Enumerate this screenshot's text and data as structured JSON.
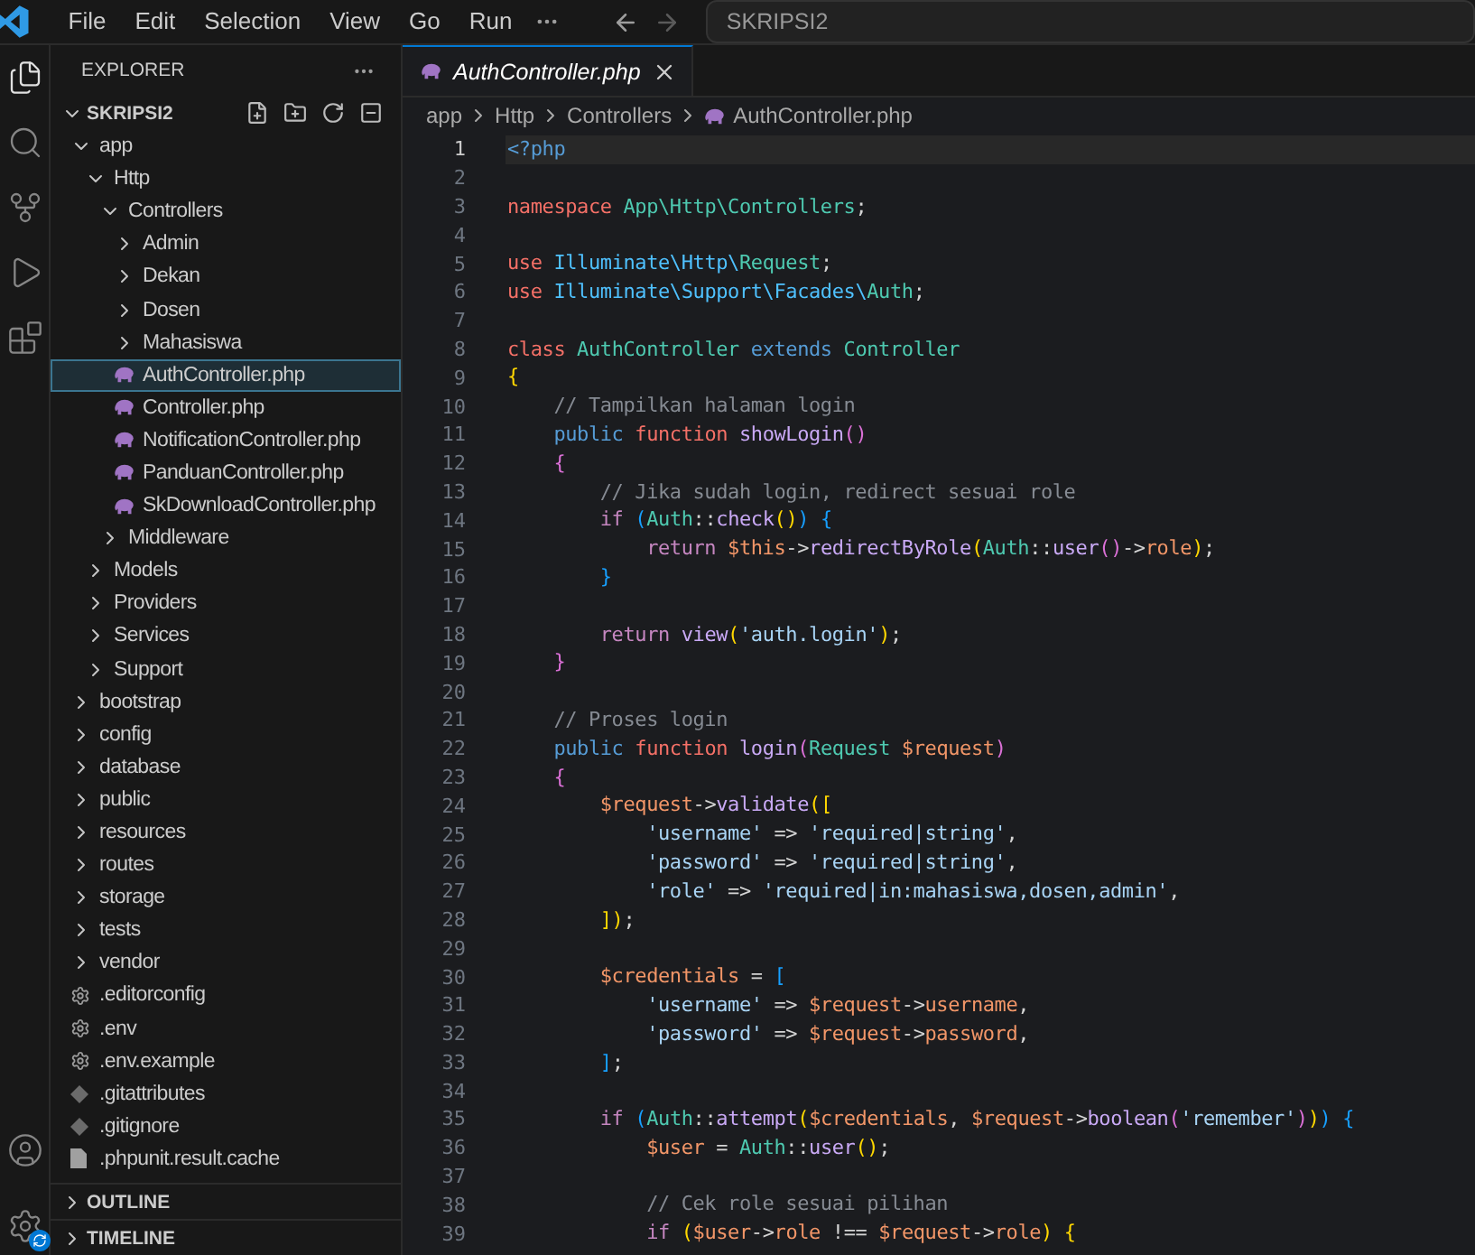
{
  "title_bar": {
    "menu": [
      "File",
      "Edit",
      "Selection",
      "View",
      "Go",
      "Run"
    ],
    "command_center": {
      "value": "SKRIPSI2"
    }
  },
  "activity_bar": [
    {
      "kind": "explorer",
      "selected": true
    },
    {
      "kind": "search",
      "selected": false
    },
    {
      "kind": "source-control",
      "selected": false
    },
    {
      "kind": "run",
      "selected": false
    },
    {
      "kind": "extensions",
      "selected": false
    }
  ],
  "activity_bar_bottom": [
    {
      "kind": "account"
    },
    {
      "kind": "settings",
      "badge": true
    }
  ],
  "sidebar": {
    "title": "EXPLORER",
    "sections": [
      {
        "title": "SKRIPSI2",
        "expanded": true,
        "items": [
          {
            "kind": "folder",
            "label": "app",
            "expanded": true,
            "selected": false,
            "children": [
              {
                "kind": "folder",
                "label": "Http",
                "expanded": true,
                "selected": false,
                "children": [
                  {
                    "kind": "folder",
                    "label": "Controllers",
                    "expanded": true,
                    "selected": false,
                    "children": [
                      {
                        "kind": "folder",
                        "label": "Admin",
                        "expanded": false,
                        "selected": false
                      },
                      {
                        "kind": "folder",
                        "label": "Dekan",
                        "expanded": false,
                        "selected": false
                      },
                      {
                        "kind": "folder",
                        "label": "Dosen",
                        "expanded": false,
                        "selected": false
                      },
                      {
                        "kind": "folder",
                        "label": "Mahasiswa",
                        "expanded": false,
                        "selected": false
                      },
                      {
                        "kind": "php",
                        "label": "AuthController.php",
                        "selected": true
                      },
                      {
                        "kind": "php",
                        "label": "Controller.php",
                        "selected": false
                      },
                      {
                        "kind": "php",
                        "label": "NotificationController.php",
                        "selected": false
                      },
                      {
                        "kind": "php",
                        "label": "PanduanController.php",
                        "selected": false
                      },
                      {
                        "kind": "php",
                        "label": "SkDownloadController.php",
                        "selected": false
                      }
                    ]
                  },
                  {
                    "kind": "folder",
                    "label": "Middleware",
                    "expanded": false,
                    "selected": false
                  }
                ]
              },
              {
                "kind": "folder",
                "label": "Models",
                "expanded": false,
                "selected": false
              },
              {
                "kind": "folder",
                "label": "Providers",
                "expanded": false,
                "selected": false
              },
              {
                "kind": "folder",
                "label": "Services",
                "expanded": false,
                "selected": false
              },
              {
                "kind": "folder",
                "label": "Support",
                "expanded": false,
                "selected": false
              }
            ]
          },
          {
            "kind": "folder",
            "label": "bootstrap",
            "expanded": false,
            "selected": false
          },
          {
            "kind": "folder",
            "label": "config",
            "expanded": false,
            "selected": false
          },
          {
            "kind": "folder",
            "label": "database",
            "expanded": false,
            "selected": false
          },
          {
            "kind": "folder",
            "label": "public",
            "expanded": false,
            "selected": false
          },
          {
            "kind": "folder",
            "label": "resources",
            "expanded": false,
            "selected": false
          },
          {
            "kind": "folder",
            "label": "routes",
            "expanded": false,
            "selected": false
          },
          {
            "kind": "folder",
            "label": "storage",
            "expanded": false,
            "selected": false
          },
          {
            "kind": "folder",
            "label": "tests",
            "expanded": false,
            "selected": false
          },
          {
            "kind": "folder",
            "label": "vendor",
            "expanded": false,
            "selected": false
          },
          {
            "kind": "config",
            "label": ".editorconfig",
            "selected": false
          },
          {
            "kind": "config",
            "label": ".env",
            "selected": false
          },
          {
            "kind": "config",
            "label": ".env.example",
            "selected": false
          },
          {
            "kind": "git",
            "label": ".gitattributes",
            "selected": false
          },
          {
            "kind": "git",
            "label": ".gitignore",
            "selected": false
          },
          {
            "kind": "file",
            "label": ".phpunit.result.cache",
            "selected": false
          }
        ]
      },
      {
        "title": "OUTLINE",
        "expanded": false
      },
      {
        "title": "TIMELINE",
        "expanded": false
      }
    ]
  },
  "tabs": [
    {
      "label": "AuthController.php",
      "selected": true,
      "preview": true
    }
  ],
  "breadcrumb": [
    "app",
    "Http",
    "Controllers",
    "AuthController.php"
  ],
  "editor": {
    "lines": [
      {
        "number": "1",
        "current": true,
        "tokens": [
          {
            "text": "<?php",
            "kind": "tag"
          }
        ]
      },
      {
        "number": "2",
        "current": false
      },
      {
        "number": "3",
        "current": false,
        "tokens": [
          {
            "text": "namespace",
            "kind": "kw"
          },
          {
            "text": " App\\Http\\Controllers",
            "kind": "ns"
          },
          {
            "text": ";",
            "kind": "pl"
          }
        ]
      },
      {
        "number": "4",
        "current": false
      },
      {
        "number": "5",
        "current": false,
        "tokens": [
          {
            "text": "use",
            "kind": "kw"
          },
          {
            "text": " Illuminate\\Http\\",
            "kind": "nsb"
          },
          {
            "text": "Request",
            "kind": "ns"
          },
          {
            "text": ";",
            "kind": "pl"
          }
        ]
      },
      {
        "number": "6",
        "current": false,
        "tokens": [
          {
            "text": "use",
            "kind": "kw"
          },
          {
            "text": " Illuminate\\Support\\Facades\\",
            "kind": "nsb"
          },
          {
            "text": "Auth",
            "kind": "ns"
          },
          {
            "text": ";",
            "kind": "pl"
          }
        ]
      },
      {
        "number": "7",
        "current": false
      },
      {
        "number": "8",
        "current": false,
        "tokens": [
          {
            "text": "class",
            "kind": "kw"
          },
          {
            "text": " AuthController",
            "kind": "ns"
          },
          {
            "text": " extends",
            "kind": "st"
          },
          {
            "text": " Controller",
            "kind": "ns"
          }
        ]
      },
      {
        "number": "9",
        "current": false,
        "tokens": [
          {
            "text": "{",
            "kind": "b1"
          }
        ]
      },
      {
        "number": "10",
        "current": false,
        "tokens": [
          {
            "text": "    // Tampilkan halaman login",
            "kind": "cm"
          }
        ]
      },
      {
        "number": "11",
        "current": false,
        "tokens": [
          {
            "text": "    public",
            "kind": "st"
          },
          {
            "text": " function",
            "kind": "kw"
          },
          {
            "text": " showLogin",
            "kind": "fn"
          },
          {
            "text": "()",
            "kind": "b2"
          }
        ]
      },
      {
        "number": "12",
        "current": false,
        "tokens": [
          {
            "text": "    {",
            "kind": "b2"
          }
        ]
      },
      {
        "number": "13",
        "current": false,
        "tokens": [
          {
            "text": "        // Jika sudah login, redirect sesuai role",
            "kind": "cm"
          }
        ]
      },
      {
        "number": "14",
        "current": false,
        "tokens": [
          {
            "text": "        if ",
            "kind": "ctl"
          },
          {
            "text": "(",
            "kind": "b3"
          },
          {
            "text": "Auth",
            "kind": "ns"
          },
          {
            "text": "::",
            "kind": "pl"
          },
          {
            "text": "check",
            "kind": "fn"
          },
          {
            "text": "()",
            "kind": "b1"
          },
          {
            "text": ")",
            "kind": "b3"
          },
          {
            "text": " {",
            "kind": "b3"
          }
        ]
      },
      {
        "number": "15",
        "current": false,
        "tokens": [
          {
            "text": "            return",
            "kind": "ctl"
          },
          {
            "text": " $this",
            "kind": "var"
          },
          {
            "text": "->",
            "kind": "pl"
          },
          {
            "text": "redirectByRole",
            "kind": "fn"
          },
          {
            "text": "(",
            "kind": "b1"
          },
          {
            "text": "Auth",
            "kind": "ns"
          },
          {
            "text": "::",
            "kind": "pl"
          },
          {
            "text": "user",
            "kind": "fn"
          },
          {
            "text": "()",
            "kind": "b2"
          },
          {
            "text": "->",
            "kind": "pl"
          },
          {
            "text": "role",
            "kind": "var"
          },
          {
            "text": ")",
            "kind": "b1"
          },
          {
            "text": ";",
            "kind": "pl"
          }
        ]
      },
      {
        "number": "16",
        "current": false,
        "tokens": [
          {
            "text": "        }",
            "kind": "b3"
          }
        ]
      },
      {
        "number": "17",
        "current": false
      },
      {
        "number": "18",
        "current": false,
        "tokens": [
          {
            "text": "        return",
            "kind": "ctl"
          },
          {
            "text": " view",
            "kind": "fn"
          },
          {
            "text": "(",
            "kind": "b1"
          },
          {
            "text": "'auth.login'",
            "kind": "str"
          },
          {
            "text": ")",
            "kind": "b1"
          },
          {
            "text": ";",
            "kind": "pl"
          }
        ]
      },
      {
        "number": "19",
        "current": false,
        "tokens": [
          {
            "text": "    }",
            "kind": "b2"
          }
        ]
      },
      {
        "number": "20",
        "current": false
      },
      {
        "number": "21",
        "current": false,
        "tokens": [
          {
            "text": "    // Proses login",
            "kind": "cm"
          }
        ]
      },
      {
        "number": "22",
        "current": false,
        "tokens": [
          {
            "text": "    public",
            "kind": "st"
          },
          {
            "text": " function",
            "kind": "kw"
          },
          {
            "text": " login",
            "kind": "fn"
          },
          {
            "text": "(",
            "kind": "b2"
          },
          {
            "text": "Request",
            "kind": "ns"
          },
          {
            "text": " $request",
            "kind": "var"
          },
          {
            "text": ")",
            "kind": "b2"
          }
        ]
      },
      {
        "number": "23",
        "current": false,
        "tokens": [
          {
            "text": "    {",
            "kind": "b2"
          }
        ]
      },
      {
        "number": "24",
        "current": false,
        "tokens": [
          {
            "text": "        $request",
            "kind": "var"
          },
          {
            "text": "->",
            "kind": "pl"
          },
          {
            "text": "validate",
            "kind": "fn"
          },
          {
            "text": "([",
            "kind": "b1"
          }
        ]
      },
      {
        "number": "25",
        "current": false,
        "tokens": [
          {
            "text": "            'username'",
            "kind": "str"
          },
          {
            "text": " => ",
            "kind": "pl"
          },
          {
            "text": "'required|string'",
            "kind": "str"
          },
          {
            "text": ",",
            "kind": "pl"
          }
        ]
      },
      {
        "number": "26",
        "current": false,
        "tokens": [
          {
            "text": "            'password'",
            "kind": "str"
          },
          {
            "text": " => ",
            "kind": "pl"
          },
          {
            "text": "'required|string'",
            "kind": "str"
          },
          {
            "text": ",",
            "kind": "pl"
          }
        ]
      },
      {
        "number": "27",
        "current": false,
        "tokens": [
          {
            "text": "            'role'",
            "kind": "str"
          },
          {
            "text": " => ",
            "kind": "pl"
          },
          {
            "text": "'required|in:mahasiswa,dosen,admin'",
            "kind": "str"
          },
          {
            "text": ",",
            "kind": "pl"
          }
        ]
      },
      {
        "number": "28",
        "current": false,
        "tokens": [
          {
            "text": "        ])",
            "kind": "b1"
          },
          {
            "text": ";",
            "kind": "pl"
          }
        ]
      },
      {
        "number": "29",
        "current": false
      },
      {
        "number": "30",
        "current": false,
        "tokens": [
          {
            "text": "        $credentials",
            "kind": "var"
          },
          {
            "text": " = ",
            "kind": "pl"
          },
          {
            "text": "[",
            "kind": "b3"
          }
        ]
      },
      {
        "number": "31",
        "current": false,
        "tokens": [
          {
            "text": "            'username'",
            "kind": "str"
          },
          {
            "text": " => ",
            "kind": "pl"
          },
          {
            "text": "$request",
            "kind": "var"
          },
          {
            "text": "->",
            "kind": "pl"
          },
          {
            "text": "username",
            "kind": "var"
          },
          {
            "text": ",",
            "kind": "pl"
          }
        ]
      },
      {
        "number": "32",
        "current": false,
        "tokens": [
          {
            "text": "            'password'",
            "kind": "str"
          },
          {
            "text": " => ",
            "kind": "pl"
          },
          {
            "text": "$request",
            "kind": "var"
          },
          {
            "text": "->",
            "kind": "pl"
          },
          {
            "text": "password",
            "kind": "var"
          },
          {
            "text": ",",
            "kind": "pl"
          }
        ]
      },
      {
        "number": "33",
        "current": false,
        "tokens": [
          {
            "text": "        ]",
            "kind": "b3"
          },
          {
            "text": ";",
            "kind": "pl"
          }
        ]
      },
      {
        "number": "34",
        "current": false
      },
      {
        "number": "35",
        "current": false,
        "tokens": [
          {
            "text": "        if ",
            "kind": "ctl"
          },
          {
            "text": "(",
            "kind": "b3"
          },
          {
            "text": "Auth",
            "kind": "ns"
          },
          {
            "text": "::",
            "kind": "pl"
          },
          {
            "text": "attempt",
            "kind": "fn"
          },
          {
            "text": "(",
            "kind": "b1"
          },
          {
            "text": "$credentials",
            "kind": "var"
          },
          {
            "text": ", ",
            "kind": "pl"
          },
          {
            "text": "$request",
            "kind": "var"
          },
          {
            "text": "->",
            "kind": "pl"
          },
          {
            "text": "boolean",
            "kind": "fn"
          },
          {
            "text": "(",
            "kind": "b2"
          },
          {
            "text": "'remember'",
            "kind": "str"
          },
          {
            "text": ")",
            "kind": "b2"
          },
          {
            "text": ")",
            "kind": "b1"
          },
          {
            "text": ")",
            "kind": "b3"
          },
          {
            "text": " {",
            "kind": "b3"
          }
        ]
      },
      {
        "number": "36",
        "current": false,
        "tokens": [
          {
            "text": "            $user",
            "kind": "var"
          },
          {
            "text": " = ",
            "kind": "pl"
          },
          {
            "text": "Auth",
            "kind": "ns"
          },
          {
            "text": "::",
            "kind": "pl"
          },
          {
            "text": "user",
            "kind": "fn"
          },
          {
            "text": "()",
            "kind": "b1"
          },
          {
            "text": ";",
            "kind": "pl"
          }
        ]
      },
      {
        "number": "37",
        "current": false
      },
      {
        "number": "38",
        "current": false,
        "tokens": [
          {
            "text": "            // Cek role sesuai pilihan",
            "kind": "cm"
          }
        ]
      },
      {
        "number": "39",
        "current": false,
        "tokens": [
          {
            "text": "            if ",
            "kind": "ctl"
          },
          {
            "text": "(",
            "kind": "b1"
          },
          {
            "text": "$user",
            "kind": "var"
          },
          {
            "text": "->",
            "kind": "pl"
          },
          {
            "text": "role",
            "kind": "var"
          },
          {
            "text": " !== ",
            "kind": "pl"
          },
          {
            "text": "$request",
            "kind": "var"
          },
          {
            "text": "->",
            "kind": "pl"
          },
          {
            "text": "role",
            "kind": "var"
          },
          {
            "text": ")",
            "kind": "b1"
          },
          {
            "text": " {",
            "kind": "b1"
          }
        ]
      }
    ]
  }
}
